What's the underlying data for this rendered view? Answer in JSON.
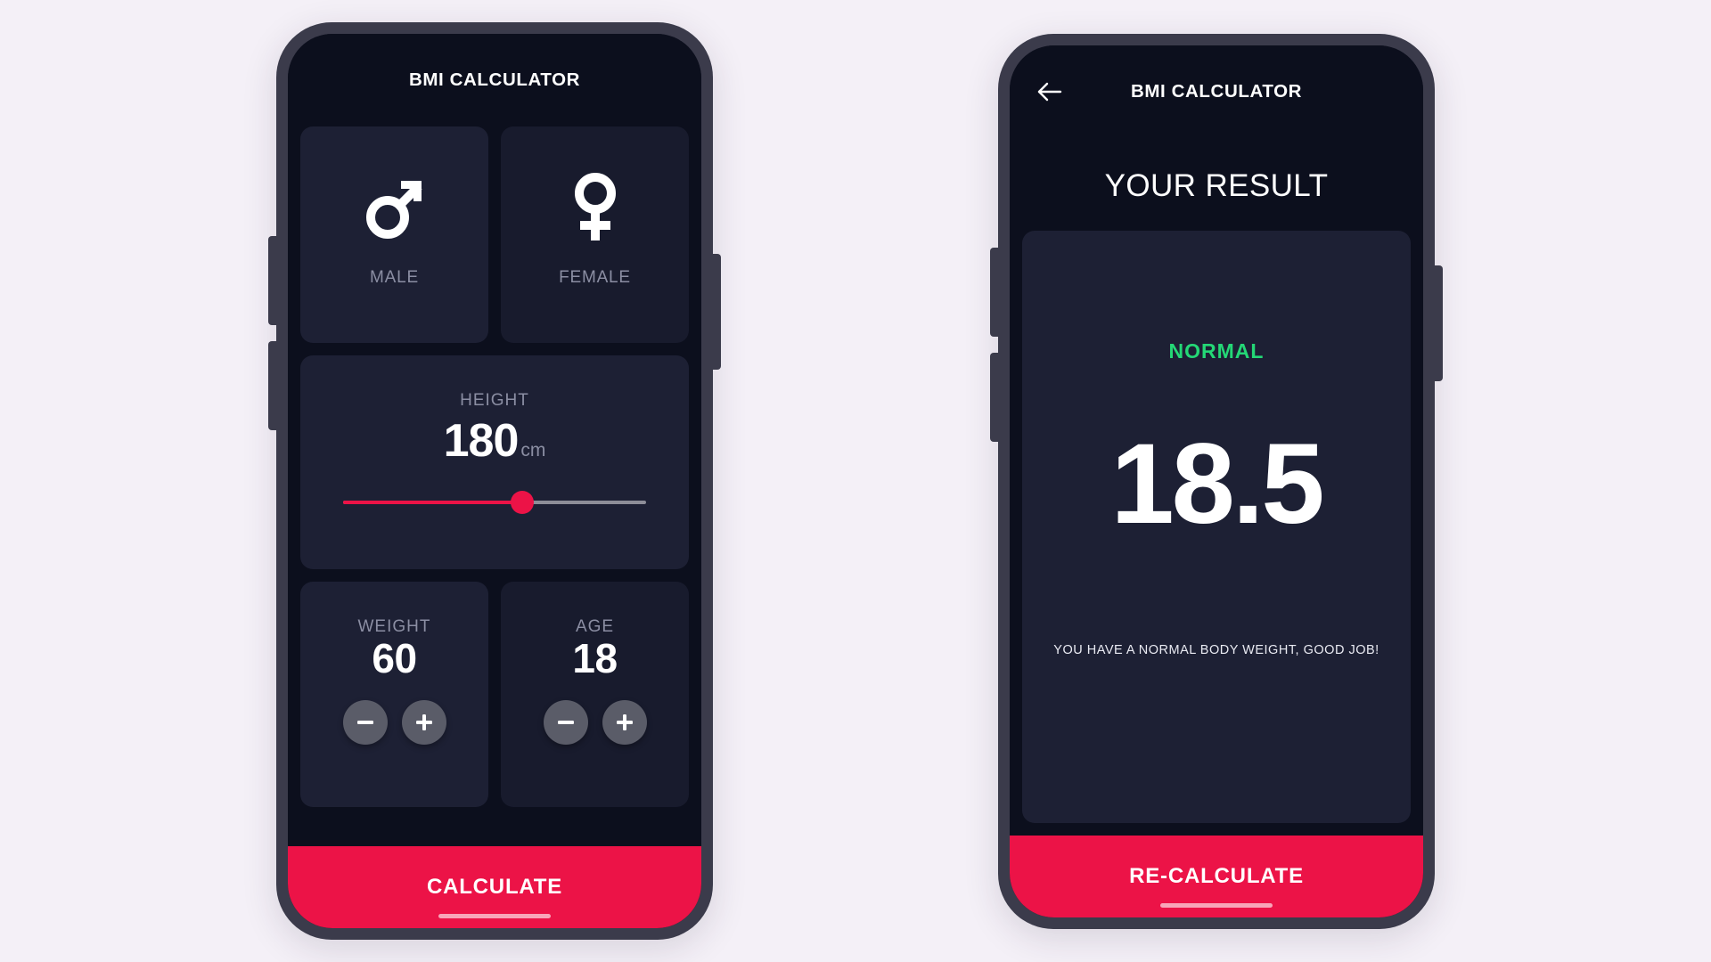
{
  "background_color": "#f4f0f7",
  "theme": {
    "accent": "#ec1347",
    "screen_bg": "#0c0f1d",
    "card_bg": "#1d2034",
    "card_bg_unselected": "#181b2d",
    "frame": "#3b3b4b",
    "muted_text": "#8b8ea3",
    "status_green": "#24d876",
    "stepper_bg": "#5a5c68"
  },
  "input_screen": {
    "appbar": {
      "title": "BMI CALCULATOR"
    },
    "gender": {
      "male": {
        "label": "MALE",
        "icon": "mars-symbol-icon",
        "selected": true
      },
      "female": {
        "label": "FEMALE",
        "icon": "venus-symbol-icon",
        "selected": false
      }
    },
    "height": {
      "label": "HEIGHT",
      "value": "180",
      "unit": "cm",
      "slider_percent": 59
    },
    "weight": {
      "label": "WEIGHT",
      "value": "60",
      "decrement_icon": "minus-icon",
      "increment_icon": "plus-icon"
    },
    "age": {
      "label": "AGE",
      "value": "18",
      "decrement_icon": "minus-icon",
      "increment_icon": "plus-icon"
    },
    "cta": {
      "label": "CALCULATE"
    }
  },
  "result_screen": {
    "appbar": {
      "title": "BMI CALCULATOR",
      "back_icon": "arrow-left-icon"
    },
    "heading": "YOUR RESULT",
    "status": "NORMAL",
    "bmi_value": "18.5",
    "description": "YOU HAVE A NORMAL BODY WEIGHT, GOOD JOB!",
    "cta": {
      "label": "RE-CALCULATE"
    }
  }
}
